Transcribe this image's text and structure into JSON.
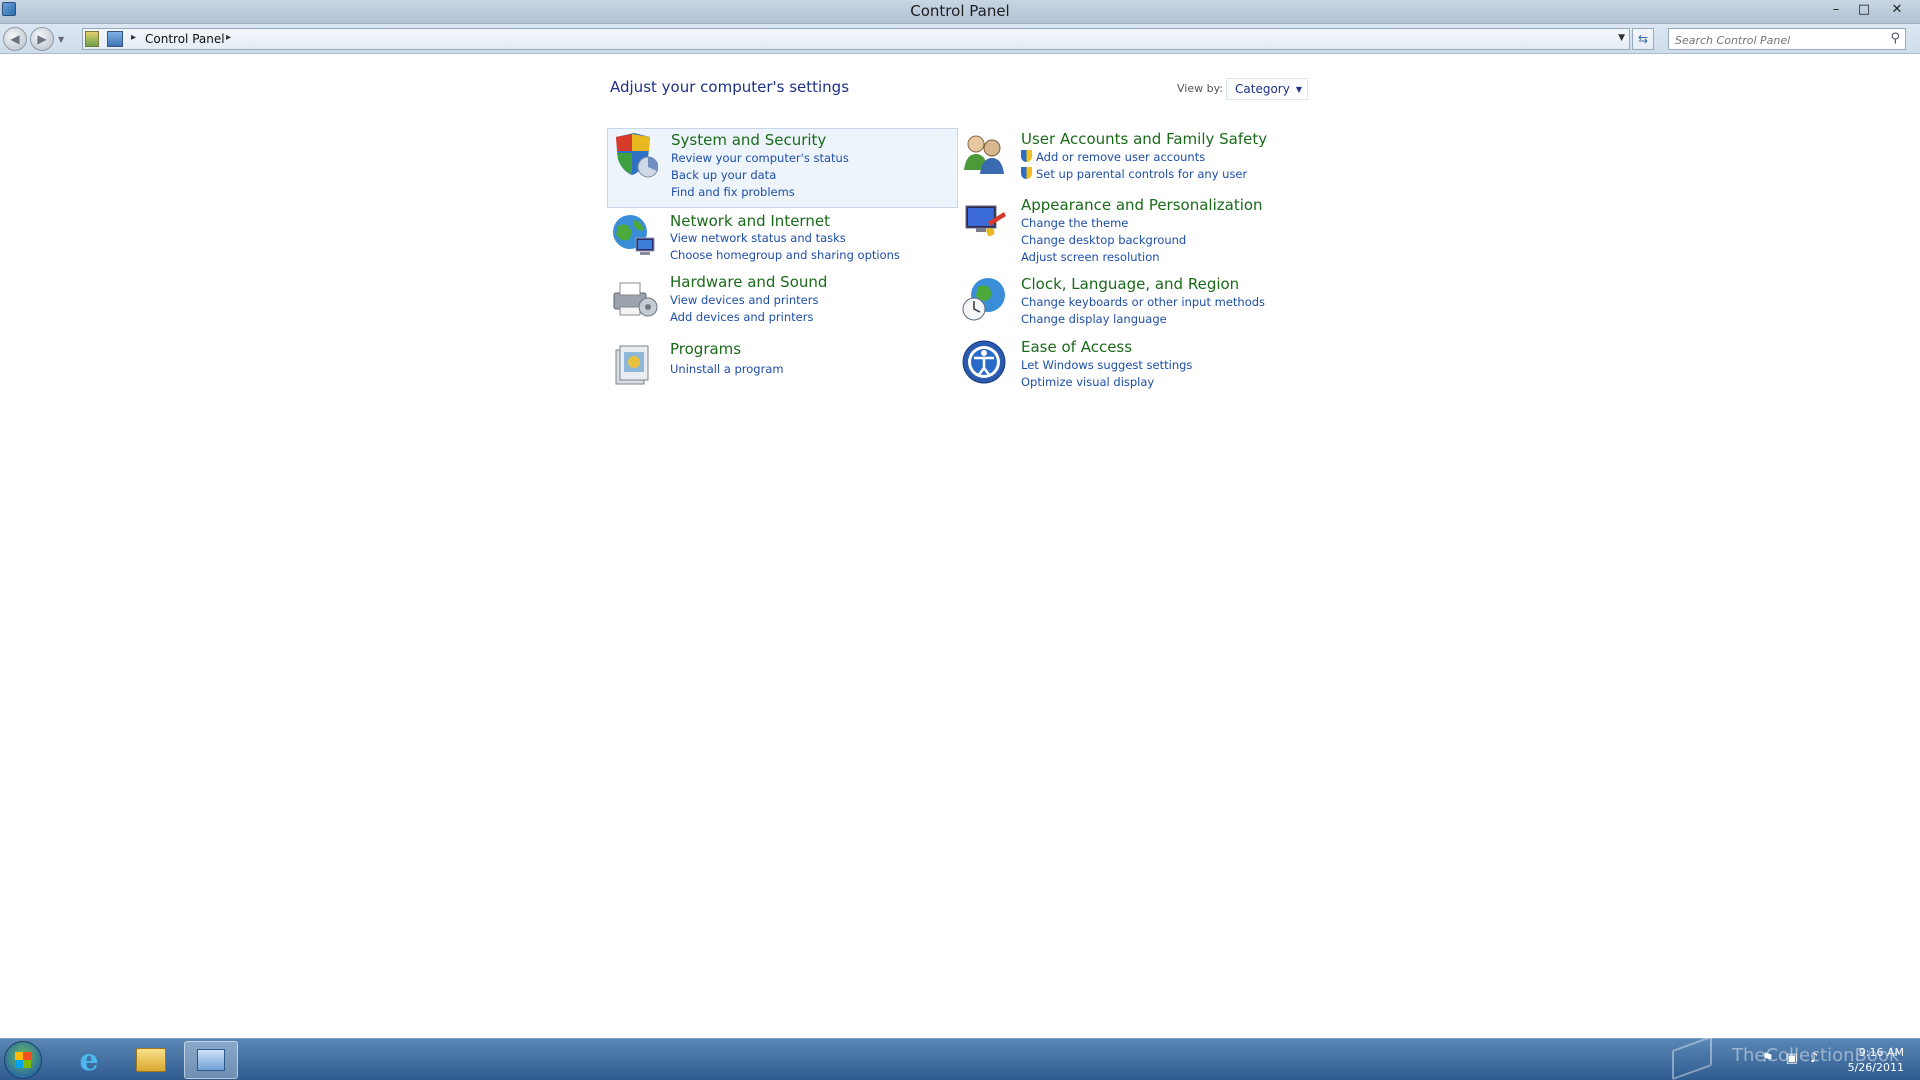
{
  "window": {
    "title": "Control Panel",
    "controls": {
      "minimize": "–",
      "maximize": "□",
      "close": "✕"
    }
  },
  "nav": {
    "back_icon": "back-arrow-icon",
    "forward_icon": "forward-arrow-icon",
    "breadcrumb": [
      "Control Panel"
    ],
    "search_placeholder": "Search Control Panel"
  },
  "content": {
    "heading": "Adjust your computer's settings",
    "view_by_label": "View by:",
    "view_by_value": "Category",
    "categories": [
      {
        "title": "System and Security",
        "icon": "shield-icon",
        "links": [
          "Review your computer's status",
          "Back up your data",
          "Find and fix problems"
        ]
      },
      {
        "title": "Network and Internet",
        "icon": "network-globe-icon",
        "links": [
          "View network status and tasks",
          "Choose homegroup and sharing options"
        ]
      },
      {
        "title": "Hardware and Sound",
        "icon": "printer-icon",
        "links": [
          "View devices and printers",
          "Add devices and printers"
        ]
      },
      {
        "title": "Programs",
        "icon": "programs-icon",
        "links": [
          "Uninstall a program"
        ]
      },
      {
        "title": "User Accounts and Family Safety",
        "icon": "users-icon",
        "links": [
          "Add or remove user accounts",
          "Set up parental controls for any user"
        ]
      },
      {
        "title": "Appearance and Personalization",
        "icon": "monitor-paint-icon",
        "links": [
          "Change the theme",
          "Change desktop background",
          "Adjust screen resolution"
        ]
      },
      {
        "title": "Clock, Language, and Region",
        "icon": "clock-globe-icon",
        "links": [
          "Change keyboards or other input methods",
          "Change display language"
        ]
      },
      {
        "title": "Ease of Access",
        "icon": "ease-of-access-icon",
        "links": [
          "Let Windows suggest settings",
          "Optimize visual display"
        ]
      }
    ]
  },
  "taskbar": {
    "watermark": "TheCollectionBook",
    "time": "9:16 AM",
    "date": "5/26/2011",
    "colors": {
      "start_orb": "#2c6e9e",
      "taskbar": "#3f6c9f"
    }
  }
}
